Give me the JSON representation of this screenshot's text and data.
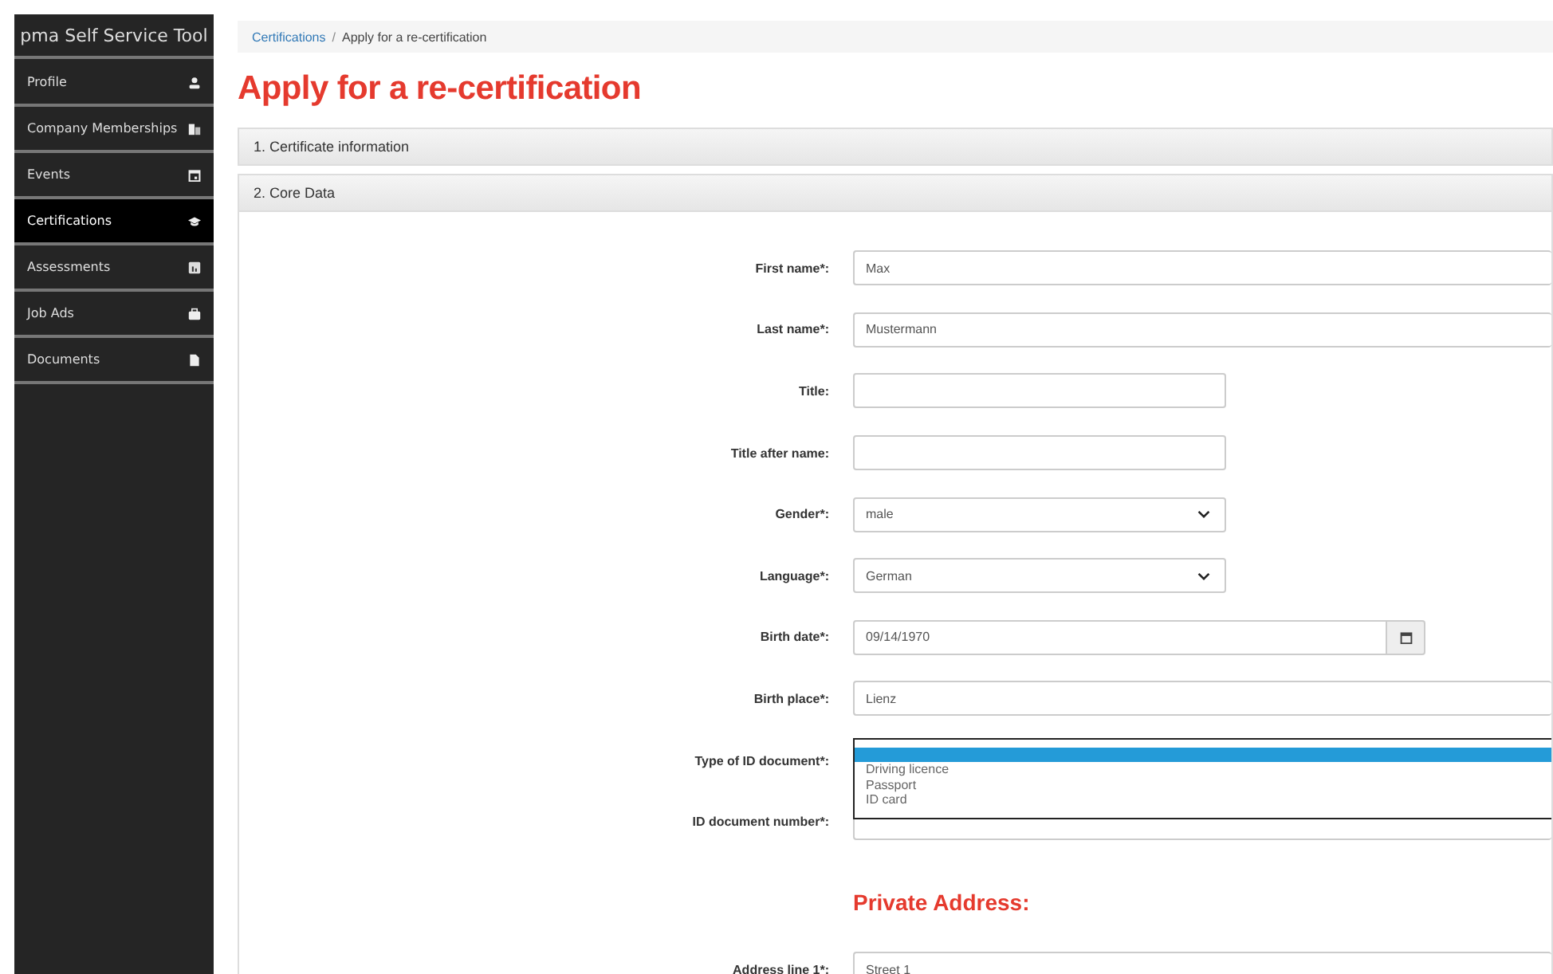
{
  "sidebar": {
    "title": "pma Self Service Tool",
    "items": [
      {
        "label": "Profile",
        "selected": false
      },
      {
        "label": "Company Memberships",
        "selected": false
      },
      {
        "label": "Events",
        "selected": false
      },
      {
        "label": "Certifications",
        "selected": true
      },
      {
        "label": "Assessments",
        "selected": false
      },
      {
        "label": "Job Ads",
        "selected": false
      },
      {
        "label": "Documents",
        "selected": false
      }
    ]
  },
  "breadcrumb_separator": "/",
  "breadcrumb": [
    {
      "label": "Certifications",
      "kind": "link"
    },
    {
      "label": "Apply for a re-certification",
      "kind": "current"
    }
  ],
  "title": "Apply for a re-certification",
  "panels": [
    {
      "label": "1. Certificate information",
      "expanded": false
    },
    {
      "label": "2. Core Data",
      "expanded": true
    }
  ],
  "fields": [
    {
      "label": "First name*:",
      "kind": "text",
      "value": "Max"
    },
    {
      "label": "Last name*:",
      "kind": "text",
      "value": "Mustermann"
    },
    {
      "label": "Title:",
      "kind": "short"
    },
    {
      "label": "Title after name:",
      "kind": "short"
    },
    {
      "label": "Gender*:",
      "kind": "select",
      "value": "male"
    },
    {
      "label": "Language*:",
      "kind": "select",
      "value": "German"
    },
    {
      "label": "Birth date*:",
      "kind": "date",
      "value": "09/14/1970"
    },
    {
      "label": "Birth place*:",
      "kind": "text",
      "value": "Lienz"
    },
    {
      "label": "Type of ID document*:",
      "kind": "listbox",
      "blank_highlighted": true,
      "options": [
        {
          "label": "Driving licence",
          "selected": false
        },
        {
          "label": "Passport",
          "selected": false
        },
        {
          "label": "ID card",
          "selected": false
        }
      ]
    },
    {
      "label": "ID document number*:",
      "kind": "text"
    }
  ],
  "address": {
    "heading": "Private Address:",
    "fields": [
      {
        "label": "Address line 1*:",
        "kind": "text",
        "value": "Street 1"
      }
    ]
  }
}
